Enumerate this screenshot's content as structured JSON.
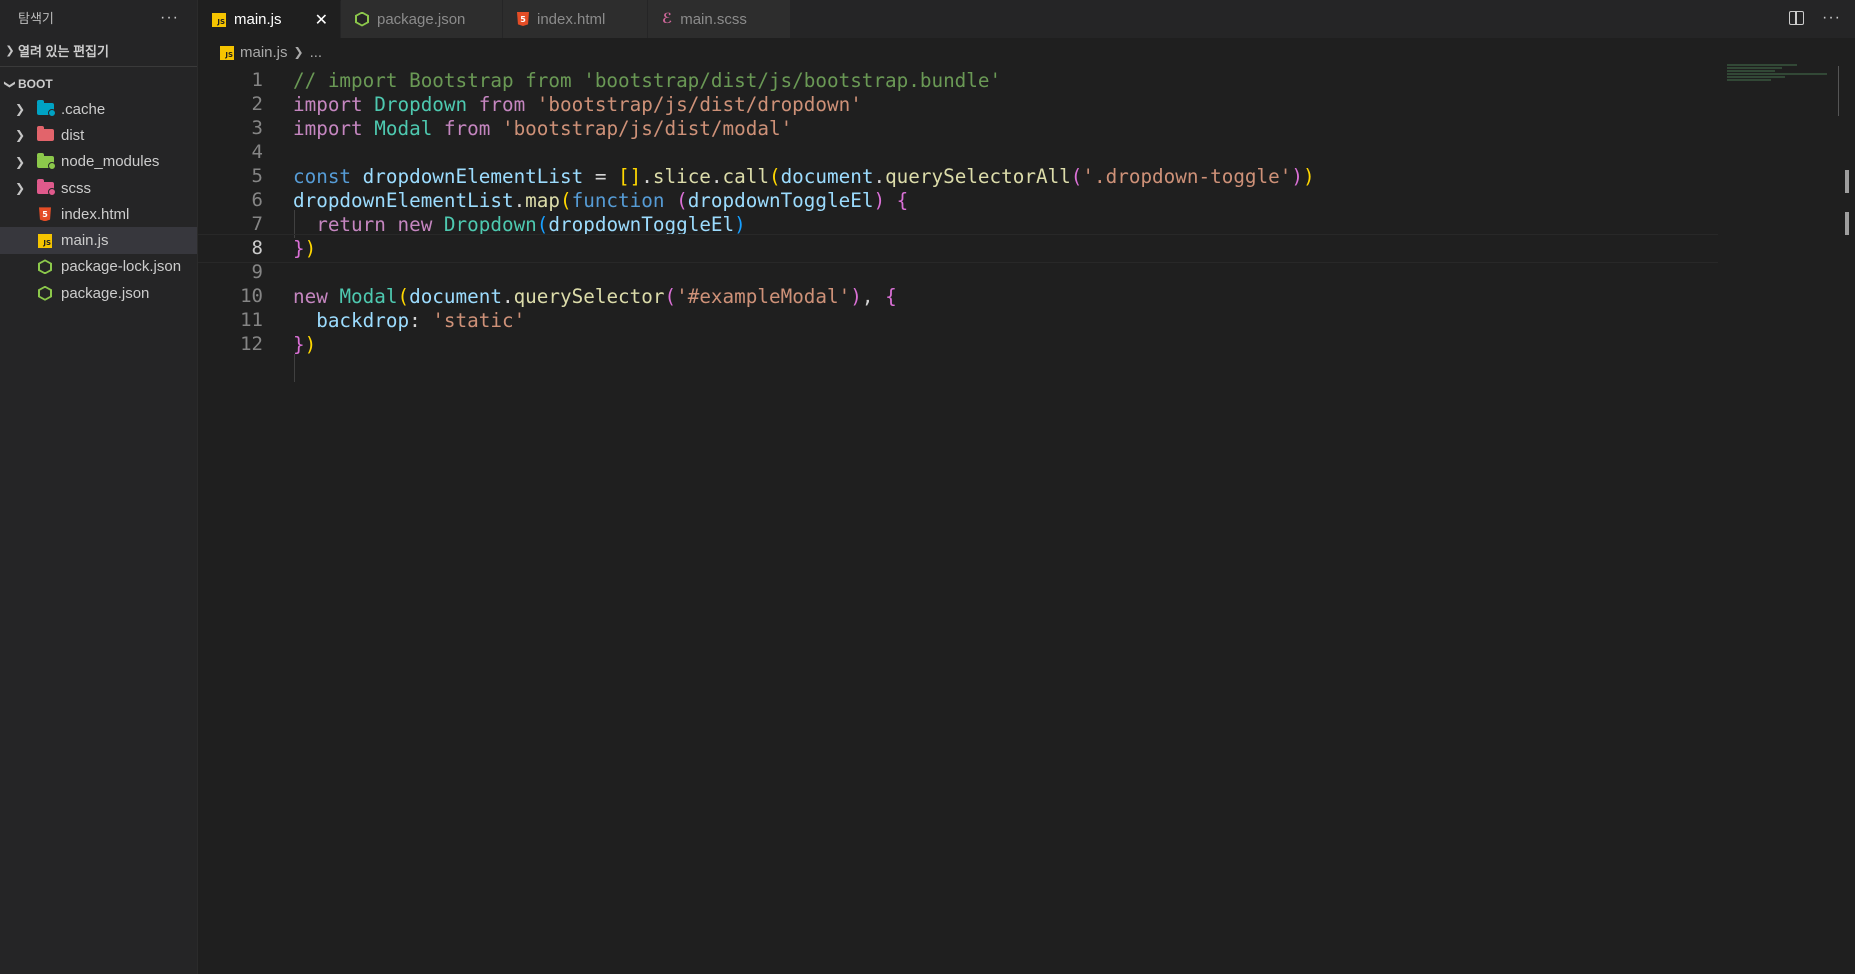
{
  "sidebar": {
    "title": "탐색기",
    "more": "···",
    "open_editors_label": "열려 있는 편집기",
    "project_label": "BOOT",
    "items": [
      {
        "label": ".cache",
        "icon": "folder-cache-icon",
        "color": "#00a3c4",
        "kind": "folder"
      },
      {
        "label": "dist",
        "icon": "folder-dist-icon",
        "color": "#e2646b",
        "kind": "folder"
      },
      {
        "label": "node_modules",
        "icon": "folder-node-icon",
        "color": "#8cc84b",
        "kind": "folder"
      },
      {
        "label": "scss",
        "icon": "folder-scss-icon",
        "color": "#e05a8c",
        "kind": "folder"
      },
      {
        "label": "index.html",
        "icon": "html-file-icon",
        "kind": "file"
      },
      {
        "label": "main.js",
        "icon": "js-file-icon",
        "kind": "file",
        "selected": true
      },
      {
        "label": "package-lock.json",
        "icon": "nodejs-file-icon",
        "kind": "file"
      },
      {
        "label": "package.json",
        "icon": "nodejs-file-icon",
        "kind": "file"
      }
    ]
  },
  "tabs": [
    {
      "label": "main.js",
      "active": true,
      "close": "✕"
    },
    {
      "label": "package.json"
    },
    {
      "label": "index.html"
    },
    {
      "label": "main.scss"
    }
  ],
  "editor_actions": {
    "more": "···"
  },
  "breadcrumb": {
    "file": "main.js",
    "rest": "..."
  },
  "editor": {
    "current_line": 8,
    "lines": [
      "// import Bootstrap from 'bootstrap/dist/js/bootstrap.bundle'",
      "import Dropdown from 'bootstrap/js/dist/dropdown'",
      "import Modal from 'bootstrap/js/dist/modal'",
      "",
      "const dropdownElementList = [].slice.call(document.querySelectorAll('.dropdown-toggle'))",
      "dropdownElementList.map(function (dropdownToggleEl) {",
      "  return new Dropdown(dropdownToggleEl)",
      "})",
      "",
      "new Modal(document.querySelector('#exampleModal'), {",
      "  backdrop: 'static'",
      "})"
    ],
    "line_numbers": [
      "1",
      "2",
      "3",
      "4",
      "5",
      "6",
      "7",
      "8",
      "9",
      "10",
      "11",
      "12"
    ]
  },
  "colors": {
    "background": "#1f1f1f",
    "sidebar": "#252526",
    "keyword": "#c586c0",
    "string": "#ce9178",
    "comment": "#6a9955"
  }
}
